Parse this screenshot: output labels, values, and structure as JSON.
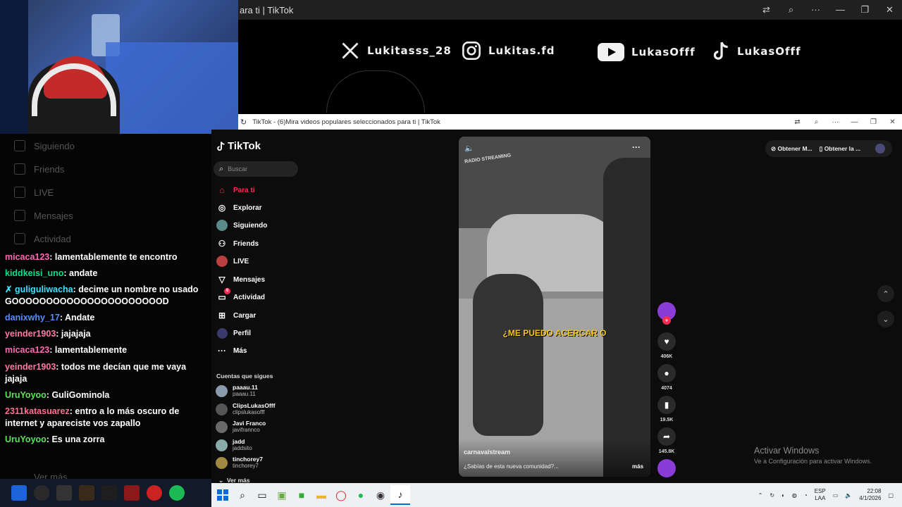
{
  "outer_window": {
    "title": "ara ti | TikTok"
  },
  "inner_window": {
    "title": "TikTok - (6)Mira videos populares seleccionados para ti | TikTok"
  },
  "socials": [
    {
      "icon": "x-icon",
      "handle": "Lukitasss_28"
    },
    {
      "icon": "instagram-icon",
      "handle": "Lukitas.fd"
    },
    {
      "icon": "youtube-icon",
      "handle": "LukasOfff"
    },
    {
      "icon": "tiktok-icon",
      "handle": "LukasOfff"
    }
  ],
  "ghost_nav": [
    "Siguiendo",
    "Friends",
    "LIVE",
    "Mensajes",
    "Actividad",
    "Ver más"
  ],
  "chat": [
    {
      "user": "micaca123",
      "color": "#ff69b4",
      "text": "lamentablemente te encontro"
    },
    {
      "user": "kiddkeisi_uno",
      "color": "#00e08a",
      "text": "andate"
    },
    {
      "user": "guliguliwacha",
      "color": "#40e0ff",
      "text": "decime un nombre no usado GOOOOOOOOOOOOOOOOOOOOOOD",
      "badge": true
    },
    {
      "user": "danixwhy_17",
      "color": "#5b8cff",
      "text": "Andate"
    },
    {
      "user": "yeinder1903",
      "color": "#ff7aa8",
      "text": "jajajaja"
    },
    {
      "user": "micaca123",
      "color": "#ff69b4",
      "text": "lamentablemente"
    },
    {
      "user": "yeinder1903",
      "color": "#ff7aa8",
      "text": "todos me decían que me vaya jajaja"
    },
    {
      "user": "UruYoyoo",
      "color": "#5fe05f",
      "text": "GuliGominola"
    },
    {
      "user": "2311katasuarez",
      "color": "#ff6f8f",
      "text": "entro a lo más oscuro de internet y apareciste vos zapallo"
    },
    {
      "user": "UruYoyoo",
      "color": "#5fe05f",
      "text": "Es una zorra"
    }
  ],
  "tiktok": {
    "logo": "TikTok",
    "search_placeholder": "Buscar",
    "nav": [
      {
        "label": "Para ti",
        "icon": "home-icon",
        "active": true
      },
      {
        "label": "Explorar",
        "icon": "compass-icon"
      },
      {
        "label": "Siguiendo",
        "icon": "following-avatar-icon"
      },
      {
        "label": "Friends",
        "icon": "friends-icon"
      },
      {
        "label": "LIVE",
        "icon": "live-icon"
      },
      {
        "label": "Mensajes",
        "icon": "send-icon"
      },
      {
        "label": "Actividad",
        "icon": "activity-icon",
        "badge": "6"
      },
      {
        "label": "Cargar",
        "icon": "upload-icon"
      },
      {
        "label": "Perfil",
        "icon": "profile-icon"
      },
      {
        "label": "Más",
        "icon": "more-icon"
      }
    ],
    "following_header": "Cuentas que sigues",
    "following": [
      {
        "name": "paaau.11",
        "handle": "paaau.11"
      },
      {
        "name": "ClipsLukasOfff",
        "handle": "clipslukasofff"
      },
      {
        "name": "Javi Franco",
        "handle": "javifrannco"
      },
      {
        "name": "jadd",
        "handle": "jaddsito"
      },
      {
        "name": "tinchorey7",
        "handle": "tinchorey7"
      }
    ],
    "ver_mas": "Ver más",
    "video": {
      "caption_overlay": "¿ME PUEDO ACERCAR O",
      "author": "carnavalstream",
      "description": "¿Sabías de esta nueva comunidad?...",
      "more": "más",
      "sign": "RADIO STREAMING"
    },
    "actions": {
      "likes": "406K",
      "comments": "4074",
      "saves": "19.5K",
      "shares": "145.8K"
    },
    "top_right": {
      "btn1": "Obtener M...",
      "btn2": "Obtener la ..."
    }
  },
  "activate_windows": {
    "title": "Activar Windows",
    "subtitle": "Ve a Configuración para activar Windows."
  },
  "tray": {
    "lang1": "ESP",
    "lang2": "LAA",
    "time": "22:08",
    "date": "4/1/2026"
  }
}
